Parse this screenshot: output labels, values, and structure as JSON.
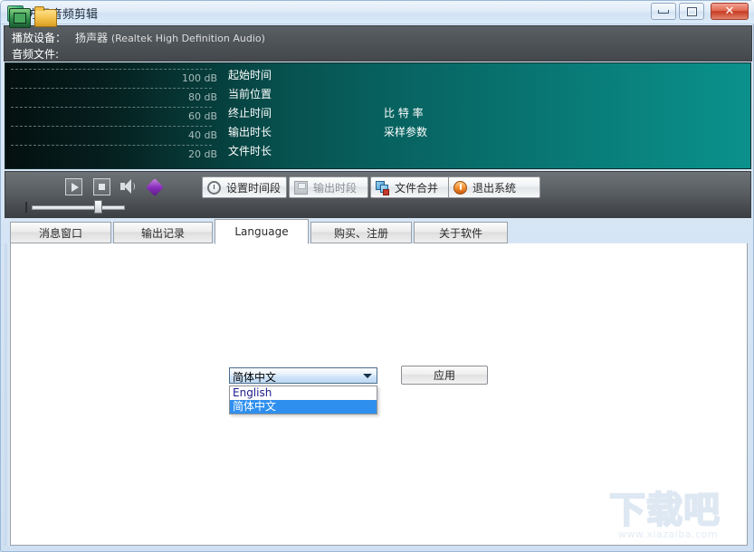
{
  "window": {
    "title": "方讯音频剪辑",
    "app_icon": "music-note-icon",
    "minimize_label": "",
    "maximize_label": "",
    "close_label": "✕"
  },
  "info": {
    "device_label": "播放设备：",
    "device_value": "扬声器",
    "device_detail": "(Realtek High Definition Audio)",
    "file_label": "音频文件:",
    "file_value": ""
  },
  "display": {
    "db_scale": [
      "100 dB",
      "80 dB",
      "60 dB",
      "40 dB",
      "20 dB"
    ],
    "fields_col1": [
      "起始时间",
      "当前位置",
      "终止时间",
      "输出时长",
      "文件时长"
    ],
    "fields_col2": [
      "比 特 率",
      "采样参数"
    ]
  },
  "toolbar": {
    "icons": [
      {
        "name": "money-icon"
      },
      {
        "name": "open-folder-icon"
      },
      {
        "name": "play-icon"
      },
      {
        "name": "stop-icon"
      },
      {
        "name": "speaker-icon"
      },
      {
        "name": "book-icon"
      }
    ],
    "buttons": [
      {
        "label": "设置时间段",
        "icon": "clock-icon",
        "disabled": false
      },
      {
        "label": "输出时段",
        "icon": "save-icon",
        "disabled": true
      },
      {
        "label": "文件合并",
        "icon": "merge-icon",
        "disabled": false
      },
      {
        "label": "退出系统",
        "icon": "power-icon",
        "disabled": false
      }
    ]
  },
  "tabs": [
    {
      "label": "消息窗口",
      "active": false
    },
    {
      "label": "输出记录",
      "active": false
    },
    {
      "label": "Language",
      "active": true
    },
    {
      "label": "购买、注册",
      "active": false
    },
    {
      "label": "关于软件",
      "active": false
    }
  ],
  "language_panel": {
    "selected": "简体中文",
    "options": [
      {
        "label": "English",
        "selected": false
      },
      {
        "label": "简体中文",
        "selected": true
      }
    ],
    "apply_label": "应用"
  },
  "watermark": {
    "text": "下载吧",
    "url": "www.xiazaiba.com"
  },
  "colors": {
    "titlebar": "#e1ecf8",
    "close_button": "#c63a22",
    "display_teal": "#0b918c",
    "selection_blue": "#2f8fee",
    "toolbar_gray": "#5c6165"
  }
}
